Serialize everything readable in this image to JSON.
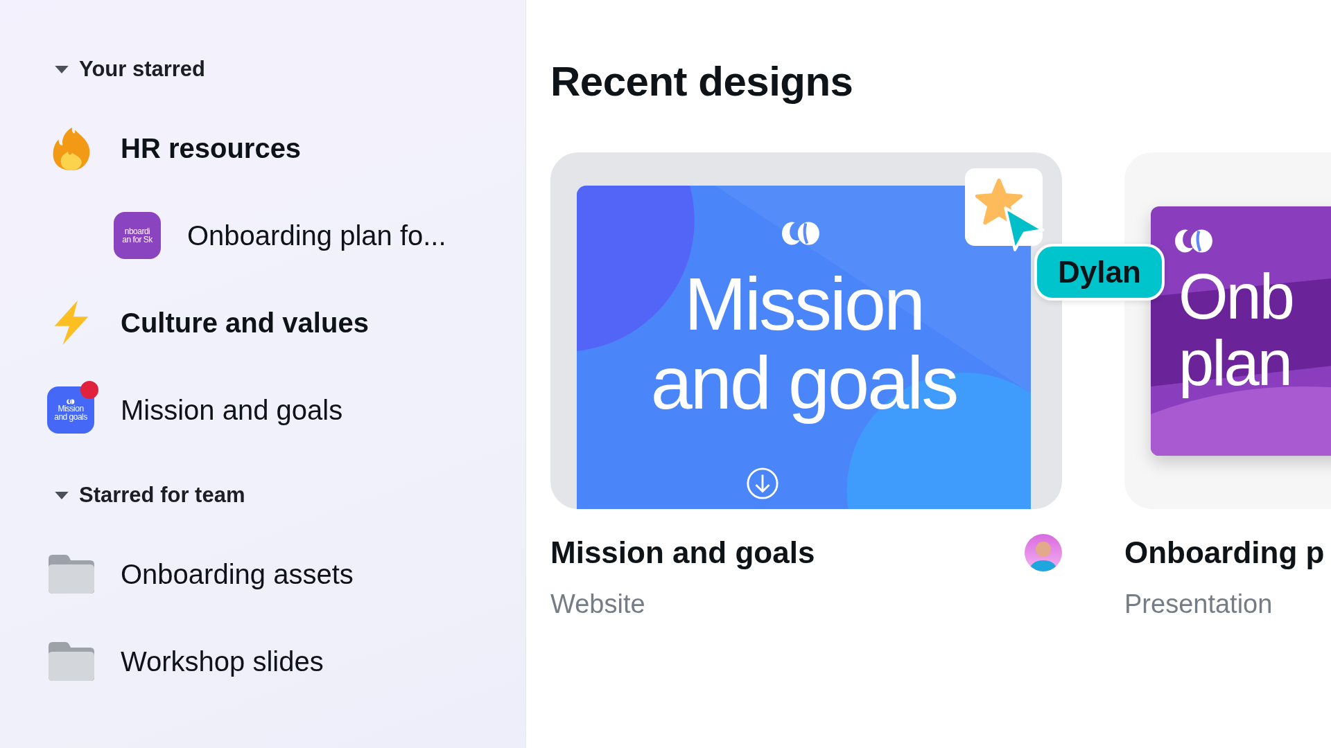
{
  "sidebar": {
    "sections": [
      {
        "title": "Your starred",
        "expanded": true,
        "items": [
          {
            "kind": "fire",
            "label": "HR resources",
            "children": [
              {
                "kind": "design",
                "label": "Onboarding plan fo...",
                "color": "#8b44c0",
                "logo": false,
                "thumb_lines": [
                  "nboardi",
                  "an for Sk"
                ],
                "unread": false
              }
            ]
          },
          {
            "kind": "bolt",
            "label": "Culture and values"
          },
          {
            "kind": "design",
            "label": "Mission and goals",
            "color": "#4569f6",
            "logo": true,
            "thumb_lines": [
              "Mission",
              "and goals"
            ],
            "unread": true
          }
        ]
      },
      {
        "title": "Starred for team",
        "expanded": true,
        "items": [
          {
            "kind": "folder",
            "label": "Onboarding assets"
          },
          {
            "kind": "folder",
            "label": "Workshop slides"
          }
        ]
      }
    ]
  },
  "main": {
    "title": "Recent designs",
    "designs": [
      {
        "title": "Mission and goals",
        "type": "Website",
        "color": "#4a86fa",
        "canvas_lines": [
          "Mission",
          "and goals"
        ],
        "starred": true,
        "cursor": {
          "name": "Dylan"
        },
        "avatar": true,
        "selected": true
      },
      {
        "title": "Onboarding p",
        "type": "Presentation",
        "color": "#8a3dbd",
        "canvas_lines": [
          "Onb",
          "plan"
        ],
        "starred": false,
        "avatar": false,
        "selected": false
      }
    ]
  }
}
